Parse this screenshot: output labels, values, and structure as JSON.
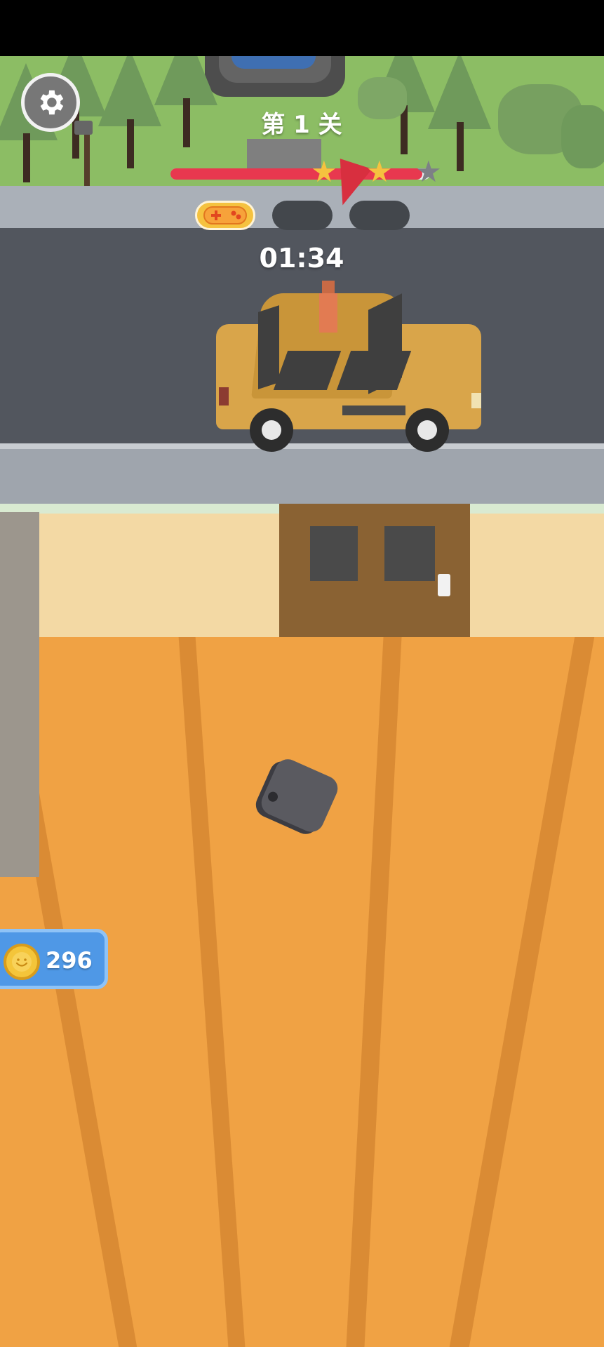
{
  "hud": {
    "level_title": "第 1 关",
    "timer": "01:34",
    "coins": "296",
    "progress": 0.97,
    "stars_earned": 2,
    "stars_total": 3,
    "powerup_slots": [
      "gamepad-icon",
      "empty",
      "empty"
    ]
  },
  "icons": {
    "settings": "gear-icon",
    "coin": "coin-icon",
    "star": "star-icon",
    "powerup": "gamepad-icon"
  },
  "colors": {
    "progress_fill": "#e8384f",
    "star_gold": "#f5c23f",
    "star_empty": "#7d8086",
    "coin_panel": "#4f98e6",
    "floor": "#f0a244",
    "taxi": "#d9a54a"
  }
}
